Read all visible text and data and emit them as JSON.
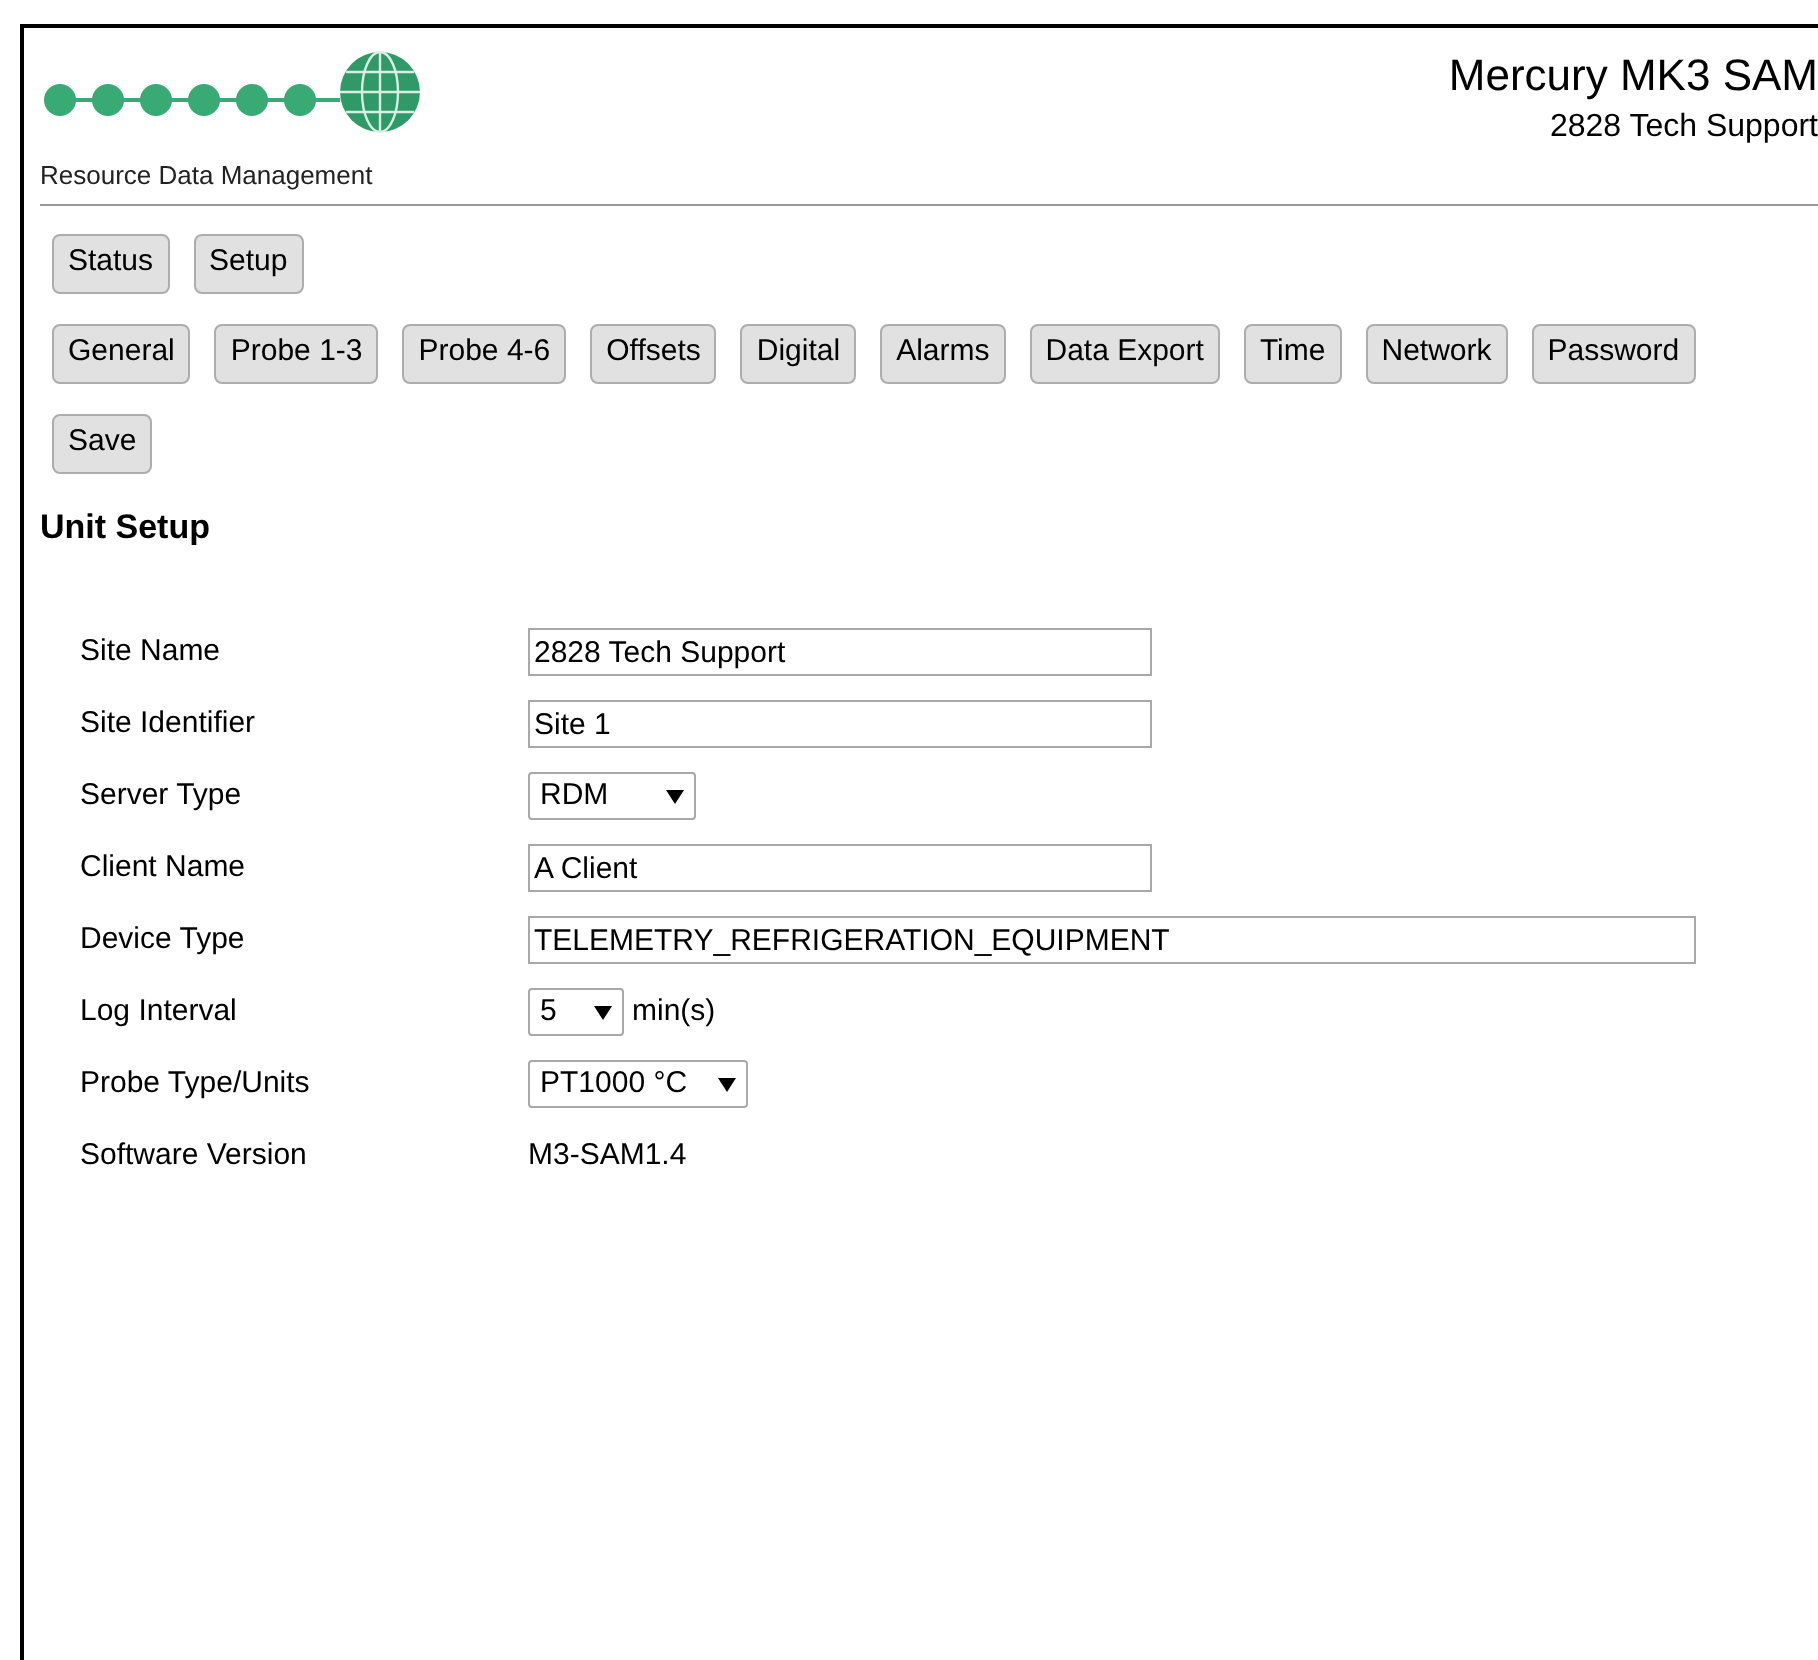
{
  "logo": {
    "caption": "Resource Data Management"
  },
  "header": {
    "title": "Mercury MK3 SAM",
    "subtitle": "2828 Tech Support"
  },
  "nav_rows": [
    [
      "Status",
      "Setup"
    ],
    [
      "General",
      "Probe 1-3",
      "Probe 4-6",
      "Offsets",
      "Digital",
      "Alarms",
      "Data Export",
      "Time",
      "Network",
      "Password"
    ],
    [
      "Save"
    ]
  ],
  "section_title": "Unit Setup",
  "fields": [
    {
      "label": "Site Name",
      "kind": "text",
      "value": "2828 Tech Support"
    },
    {
      "label": "Site Identifier",
      "kind": "text",
      "value": "Site 1"
    },
    {
      "label": "Server Type",
      "kind": "select",
      "value": "RDM"
    },
    {
      "label": "Client Name",
      "kind": "text",
      "value": "A Client"
    },
    {
      "label": "Device Type",
      "kind": "text",
      "value": "TELEMETRY_REFRIGERATION_EQUIPMENT"
    },
    {
      "label": "Log Interval",
      "kind": "select",
      "value": "5",
      "suffix": "min(s)"
    },
    {
      "label": "Probe Type/Units",
      "kind": "select",
      "value": "PT1000 °C"
    },
    {
      "label": "Software Version",
      "kind": "plain",
      "value": "M3-SAM1.4"
    }
  ]
}
